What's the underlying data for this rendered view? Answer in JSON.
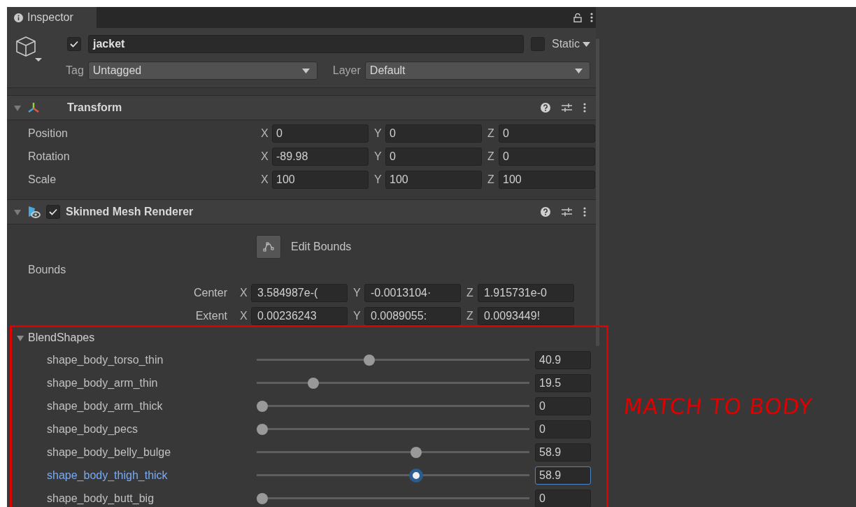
{
  "tab": {
    "label": "Inspector"
  },
  "object": {
    "active": true,
    "name": "jacket",
    "static": false,
    "static_label": "Static",
    "tag_label": "Tag",
    "tag": "Untagged",
    "layer_label": "Layer",
    "layer": "Default"
  },
  "transform": {
    "title": "Transform",
    "expanded": true,
    "rows": [
      {
        "label": "Position",
        "fields": [
          {
            "axis": "X",
            "value": "0"
          },
          {
            "axis": "Y",
            "value": "0"
          },
          {
            "axis": "Z",
            "value": "0"
          }
        ]
      },
      {
        "label": "Rotation",
        "fields": [
          {
            "axis": "X",
            "value": "-89.98"
          },
          {
            "axis": "Y",
            "value": "0"
          },
          {
            "axis": "Z",
            "value": "0"
          }
        ]
      },
      {
        "label": "Scale",
        "fields": [
          {
            "axis": "X",
            "value": "100"
          },
          {
            "axis": "Y",
            "value": "100"
          },
          {
            "axis": "Z",
            "value": "100"
          }
        ]
      }
    ]
  },
  "skinned_mesh_renderer": {
    "title": "Skinned Mesh Renderer",
    "enabled": true,
    "expanded": true,
    "edit_bounds_label": "Edit Bounds",
    "bounds_label": "Bounds",
    "bounds": [
      {
        "label": "Center",
        "fields": [
          {
            "axis": "X",
            "value": "3.584987e-("
          },
          {
            "axis": "Y",
            "value": "-0.0013104·"
          },
          {
            "axis": "Z",
            "value": "1.915731e-0"
          }
        ]
      },
      {
        "label": "Extent",
        "fields": [
          {
            "axis": "X",
            "value": "0.00236243"
          },
          {
            "axis": "Y",
            "value": "0.0089055:"
          },
          {
            "axis": "Z",
            "value": "0.0093449!"
          }
        ]
      }
    ]
  },
  "blend_shapes": {
    "title": "BlendShapes",
    "expanded": true,
    "shapes": [
      {
        "name": "shape_body_torso_thin",
        "level": 0.409,
        "value": "40.9",
        "selected": false
      },
      {
        "name": "shape_body_arm_thin",
        "level": 0.195,
        "value": "19.5",
        "selected": false
      },
      {
        "name": "shape_body_arm_thick",
        "level": 0,
        "value": "0",
        "selected": false
      },
      {
        "name": "shape_body_pecs",
        "level": 0,
        "value": "0",
        "selected": false
      },
      {
        "name": "shape_body_belly_bulge",
        "level": 0.589,
        "value": "58.9",
        "selected": false
      },
      {
        "name": "shape_body_thigh_thick",
        "level": 0.589,
        "value": "58.9",
        "selected": true
      },
      {
        "name": "shape_body_butt_big",
        "level": 0,
        "value": "0",
        "selected": false
      }
    ]
  },
  "annotation": {
    "text": "MATCH TO BODY"
  }
}
